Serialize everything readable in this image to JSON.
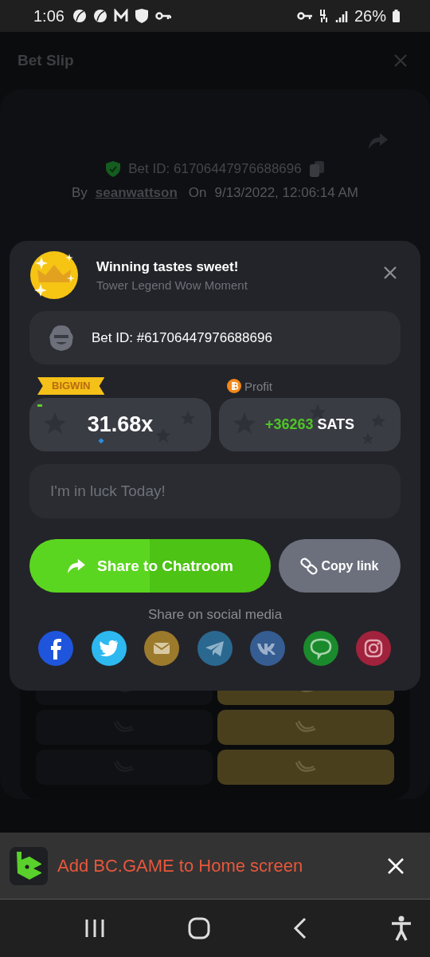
{
  "status_bar": {
    "time": "1:06",
    "battery": "26%"
  },
  "page": {
    "title": "Bet Slip",
    "bet_id": "Bet ID: 61706447976688696",
    "by_label": "By",
    "user": "seanwattson",
    "on_label": "On",
    "date": "9/13/2022, 12:06:14 AM",
    "tiles": [
      {
        "highlighted": false
      },
      {
        "highlighted": true
      },
      {
        "highlighted": false
      },
      {
        "highlighted": true
      },
      {
        "highlighted": false
      },
      {
        "highlighted": true
      }
    ]
  },
  "modal": {
    "title": "Winning tastes sweet!",
    "subtitle": "Tower Legend Wow Moment",
    "bet_id": "Bet ID: #61706447976688696",
    "badge": "BIGWIN",
    "multiplier": "31.68x",
    "profit_label": "Profit",
    "profit_amount": "+36263",
    "profit_unit": "SATS",
    "message_placeholder": "I'm in luck Today!",
    "share_button": "Share to Chatroom",
    "copy_button": "Copy link",
    "social_label": "Share on social media",
    "socials": [
      {
        "kind": "facebook",
        "color": "#1f55dc"
      },
      {
        "kind": "twitter",
        "color": "#2db8ef"
      },
      {
        "kind": "email",
        "color": "#9c7a2c"
      },
      {
        "kind": "telegram",
        "color": "#2a6890"
      },
      {
        "kind": "vk",
        "color": "#365d92"
      },
      {
        "kind": "line",
        "color": "#1b8a2c"
      },
      {
        "kind": "instagram",
        "color": "#a1223c"
      }
    ]
  },
  "banner": {
    "text": "Add BC.GAME to Home screen"
  }
}
